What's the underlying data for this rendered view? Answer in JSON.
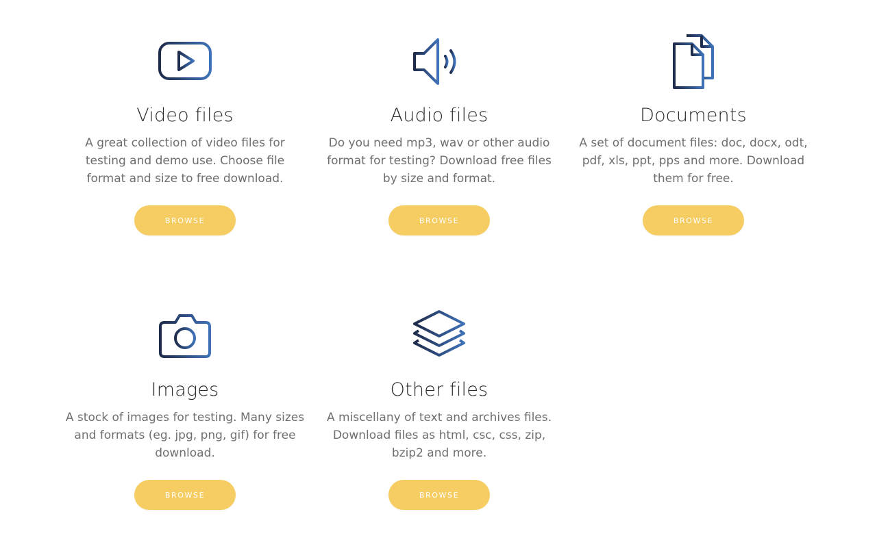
{
  "colors": {
    "icon_dark": "#1e2b4a",
    "icon_light": "#3f72b8",
    "button_bg": "#f6cd63",
    "button_text": "#ffffff",
    "title": "#2a2a2a",
    "desc": "#6f6f6f"
  },
  "cards": [
    {
      "icon": "play-video-icon",
      "title": "Video files",
      "desc": "A great collection of video files for testing and demo use. Choose file format and size to free download.",
      "button": "BROWSE"
    },
    {
      "icon": "speaker-audio-icon",
      "title": "Audio files",
      "desc": "Do you need mp3, wav or other audio format for testing? Download free files by size and format.",
      "button": "BROWSE"
    },
    {
      "icon": "documents-icon",
      "title": "Documents",
      "desc": "A set of document files: doc, docx, odt, pdf, xls, ppt, pps and more. Download them for free.",
      "button": "BROWSE"
    },
    {
      "icon": "camera-icon",
      "title": "Images",
      "desc": "A stock of images for testing. Many sizes and formats (eg. jpg, png, gif) for free download.",
      "button": "BROWSE"
    },
    {
      "icon": "layers-icon",
      "title": "Other files",
      "desc": "A miscellany of text and archives files. Download files as html, csc, css, zip, bzip2 and more.",
      "button": "BROWSE"
    }
  ]
}
